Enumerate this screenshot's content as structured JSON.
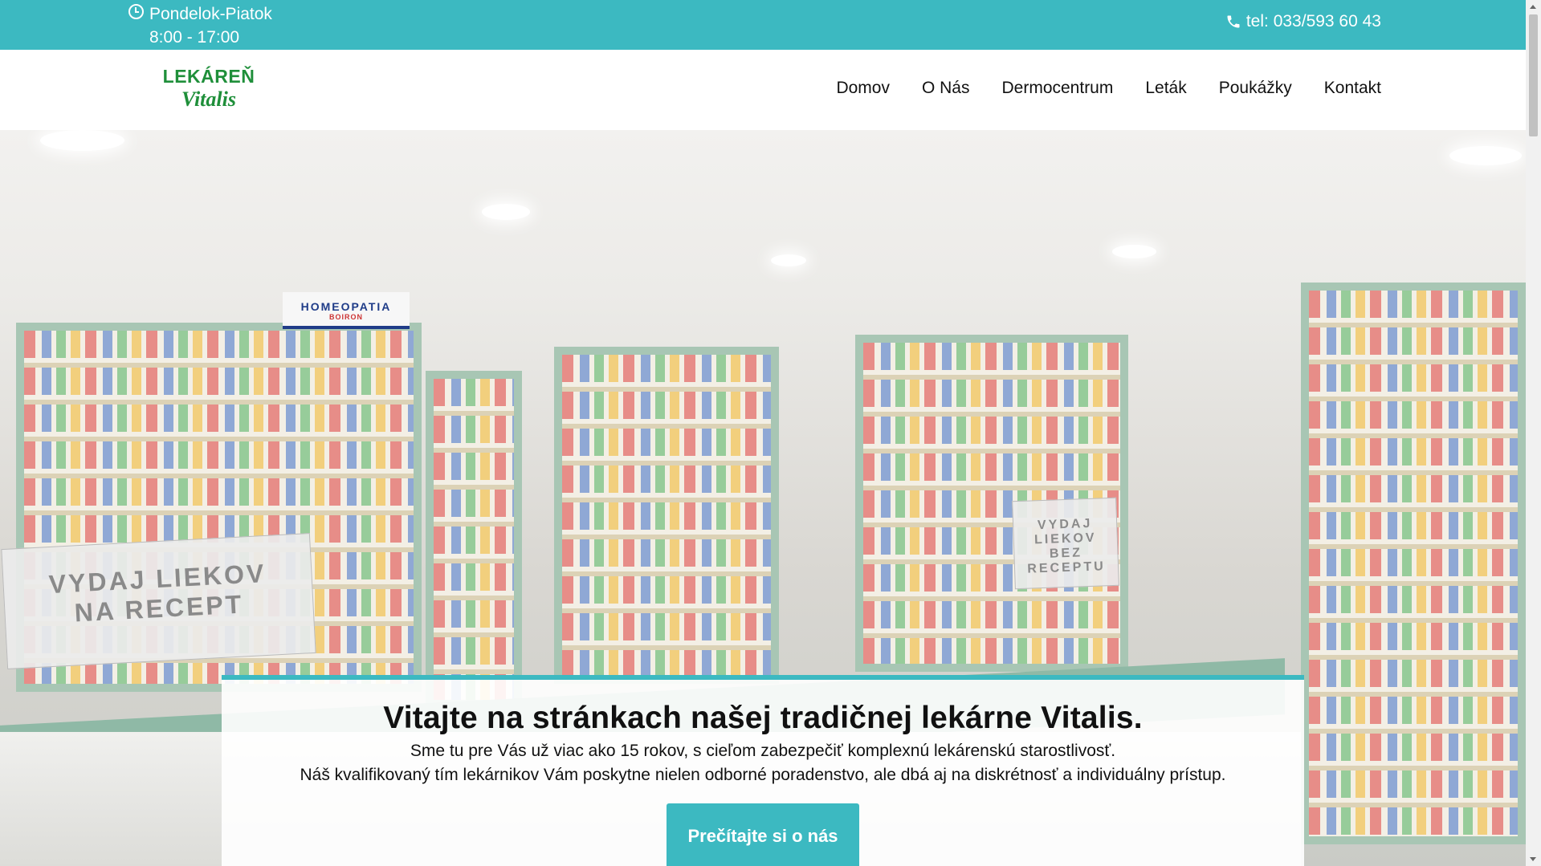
{
  "topbar": {
    "hours_days": "Pondelok-Piatok",
    "hours_time": "8:00 - 17:00",
    "phone": "tel: 033/593 60 43",
    "clock_icon": "clock-icon",
    "phone_icon": "phone-icon",
    "bg_color": "#3cb9c1"
  },
  "logo": {
    "line1": "LEKÁREŇ",
    "line2": "Vitalis",
    "color": "#1f8f3a"
  },
  "nav": {
    "items": [
      {
        "label": "Domov"
      },
      {
        "label": "O Nás"
      },
      {
        "label": "Dermocentrum"
      },
      {
        "label": "Leták"
      },
      {
        "label": "Poukážky"
      },
      {
        "label": "Kontakt"
      }
    ]
  },
  "hero": {
    "sign_left": "VYDAJ LIEKOV NA RECEPT",
    "sign_right": "VYDAJ LIEKOV BEZ RECEPTU",
    "homeopatia": "HOMEOPATIA",
    "homeopatia_brand": "BOIRON"
  },
  "welcome": {
    "title": "Vitajte na stránkach našej tradičnej lekárne Vitalis.",
    "line1": "Sme tu pre Vás už viac ako 15 rokov, s cieľom zabezpečiť komplexnú lekárenskú starostlivosť.",
    "line2": "Náš kvalifikovaný tím lekárnikov Vám poskytne nielen odborné poradenstvo, ale dbá aj na diskrétnosť a individuálny prístup.",
    "button": "Prečítajte si o nás"
  }
}
